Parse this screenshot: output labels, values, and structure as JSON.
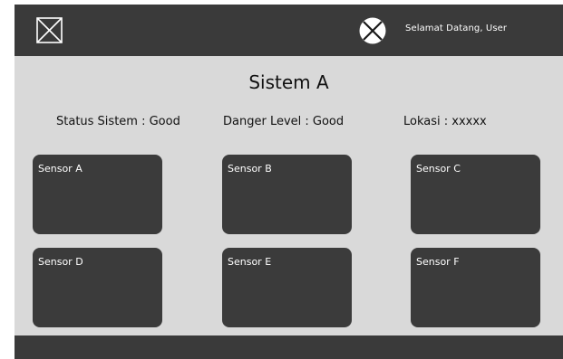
{
  "header": {
    "welcome_text": "Selamat Datang, User",
    "logo_icon": "image-placeholder-icon",
    "avatar_icon": "circle-x-icon"
  },
  "main": {
    "title": "Sistem A",
    "status_text": "Status Sistem : Good",
    "danger_text": "Danger Level : Good",
    "location_text": "Lokasi : xxxxx"
  },
  "sensors": [
    {
      "label": "Sensor A"
    },
    {
      "label": "Sensor B"
    },
    {
      "label": "Sensor C"
    },
    {
      "label": "Sensor D"
    },
    {
      "label": "Sensor E"
    },
    {
      "label": "Sensor F"
    }
  ],
  "colors": {
    "bar": "#3a3a3a",
    "background": "#d9d9d9",
    "card": "#3b3b3b",
    "text_light": "#ffffff",
    "text_dark": "#111111"
  }
}
